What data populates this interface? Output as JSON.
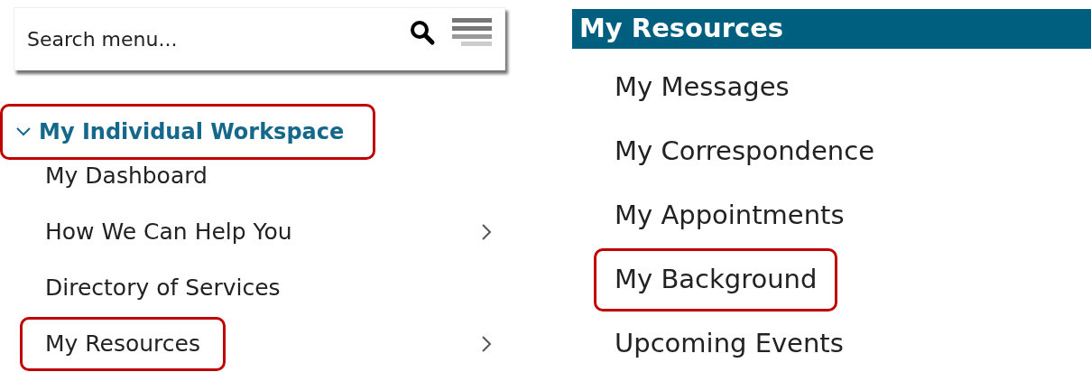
{
  "search": {
    "placeholder": "Search menu..."
  },
  "menu": {
    "label": "My Individual Workspace",
    "expanded": true,
    "highlighted": true,
    "children": [
      {
        "label": "My Dashboard",
        "has_submenu": false,
        "highlighted": false
      },
      {
        "label": "How We Can Help You",
        "has_submenu": true,
        "highlighted": false
      },
      {
        "label": "Directory of Services",
        "has_submenu": false,
        "highlighted": false
      },
      {
        "label": "My Resources",
        "has_submenu": true,
        "highlighted": true
      }
    ]
  },
  "submenu": {
    "title": "My Resources",
    "items": [
      {
        "label": "My Messages",
        "highlighted": false
      },
      {
        "label": "My Correspondence",
        "highlighted": false
      },
      {
        "label": "My Appointments",
        "highlighted": false
      },
      {
        "label": "My Background",
        "highlighted": true
      },
      {
        "label": "Upcoming Events",
        "highlighted": false
      }
    ]
  }
}
